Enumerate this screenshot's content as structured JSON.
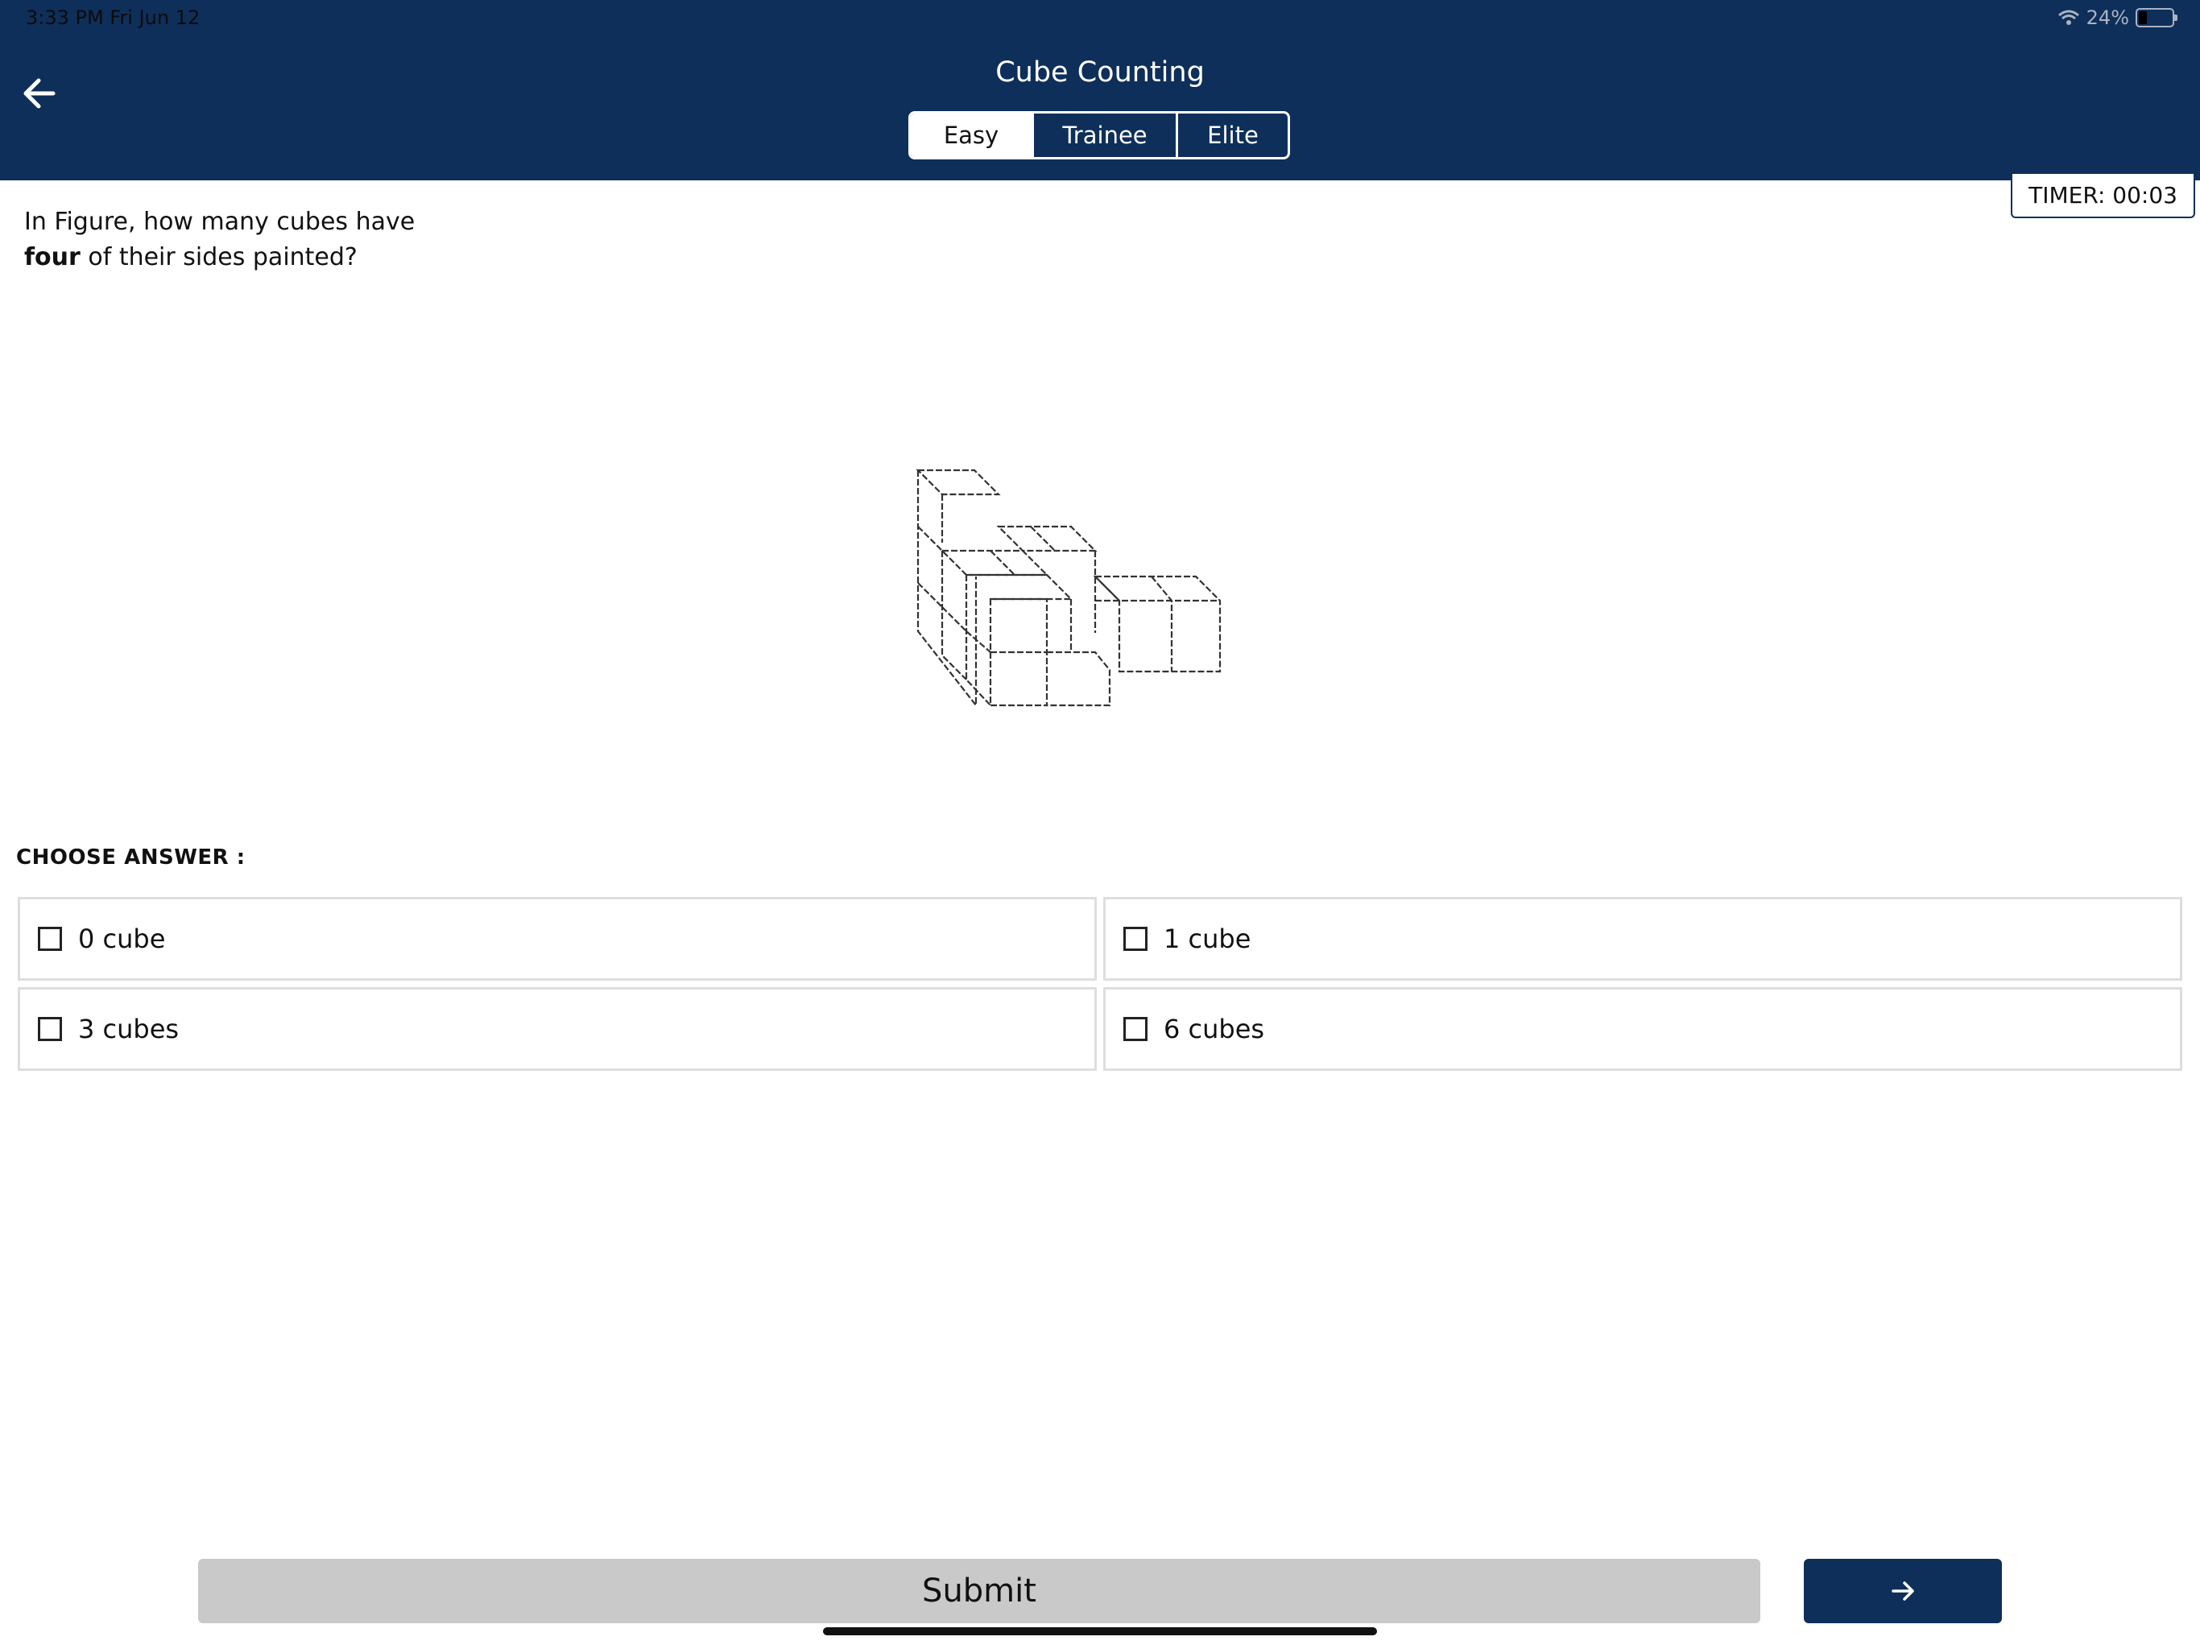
{
  "status": {
    "time": "3:33 PM   Fri Jun 12",
    "battery": "24%"
  },
  "header": {
    "title": "Cube Counting",
    "tabs": [
      {
        "label": "Easy",
        "active": true
      },
      {
        "label": "Trainee",
        "active": false
      },
      {
        "label": "Elite",
        "active": false
      }
    ]
  },
  "timer": "TIMER: 00:03",
  "question": {
    "line1": "In Figure, how many cubes have",
    "bold": "four",
    "line2_rest": " of their sides painted?"
  },
  "choose_label": "CHOOSE ANSWER :",
  "answers": [
    "0 cube",
    "1 cube",
    "3 cubes",
    "6 cubes"
  ],
  "submit_label": "Submit",
  "colors": {
    "primary": "#0e2f5a",
    "submit_bg": "#c9c9c9"
  },
  "icons": {
    "back": "arrow-left-icon",
    "next": "arrow-right-icon"
  }
}
